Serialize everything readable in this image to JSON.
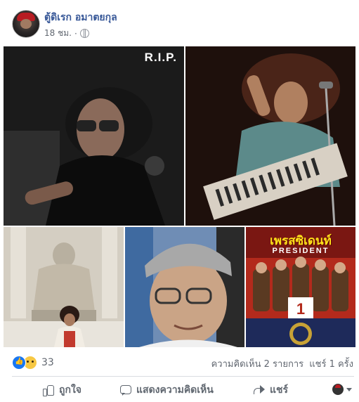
{
  "post": {
    "author": "ตู้ดิเรก อมาตยกุล",
    "timestamp": "18 ชม.",
    "privacy_icon": "globe-icon"
  },
  "photos": [
    {
      "overlay_text": "R.I.P."
    },
    {
      "overlay_text": ""
    },
    {
      "overlay_text": ""
    },
    {
      "overlay_text": ""
    },
    {
      "overlay_title": "เพรสซิเดนท์",
      "overlay_sub": "PRESIDENT"
    }
  ],
  "reactions": {
    "icons": [
      "like-icon",
      "sad-icon"
    ],
    "count": "33",
    "comments": "ความคิดเห็น 2 รายการ",
    "shares": "แชร์ 1 ครั้ง"
  },
  "actions": {
    "like": "ถูกใจ",
    "comment": "แสดงความคิดเห็น",
    "share": "แชร์"
  },
  "colors": {
    "author_link": "#385898",
    "secondary_text": "#616770",
    "like_blue": "#1877f2"
  }
}
